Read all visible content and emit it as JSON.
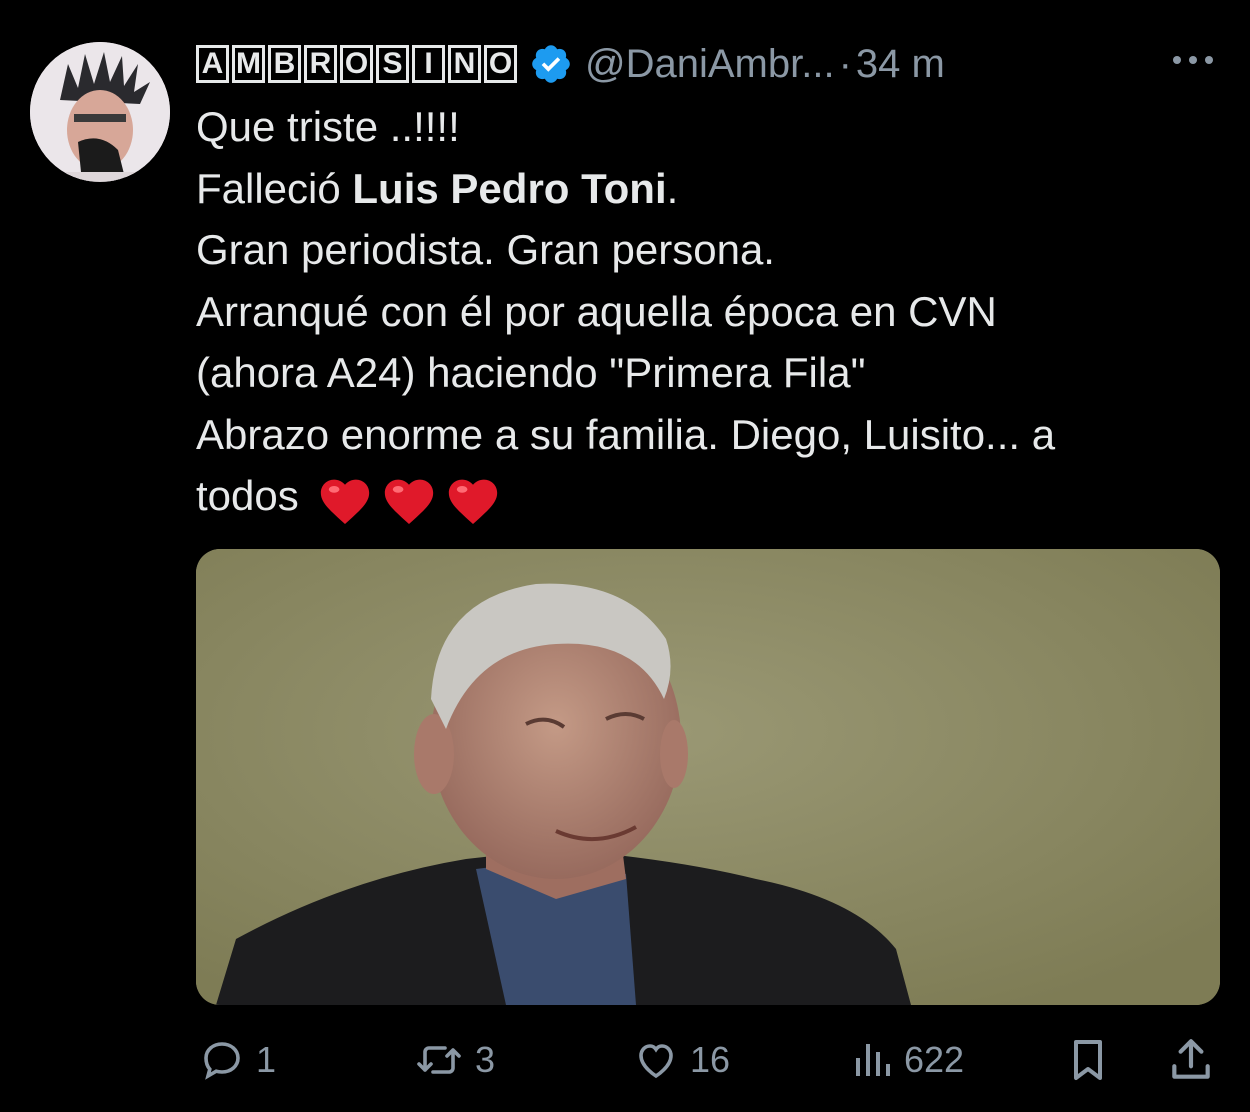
{
  "tweet": {
    "display_name_letters": [
      "A",
      "M",
      "B",
      "R",
      "O",
      "S",
      "I",
      "N",
      "O"
    ],
    "handle": "@DaniAmbr...",
    "separator": "·",
    "time": "34 m",
    "more_icon": "more-icon",
    "text_lines": [
      "Que triste ..!!!!",
      "Gran periodista. Gran persona.",
      "Arranqué con él por aquella época  en CVN",
      "(ahora A24) haciendo \"Primera Fila\"",
      "Abrazo enorme a su familia. Diego, Luisito... a"
    ],
    "line2_prefix": "Falleció ",
    "line2_bold": "Luis Pedro Toni",
    "line2_suffix": ".",
    "last_line": "todos",
    "emoji": [
      "heart",
      "heart",
      "heart"
    ]
  },
  "actions": {
    "reply_count": "1",
    "retweet_count": "3",
    "like_count": "16",
    "views_count": "622"
  },
  "colors": {
    "background": "#000000",
    "text": "#e7e9ea",
    "secondary": "#8b98a5",
    "verified": "#1d9bf0",
    "heart": "#e0192a"
  }
}
